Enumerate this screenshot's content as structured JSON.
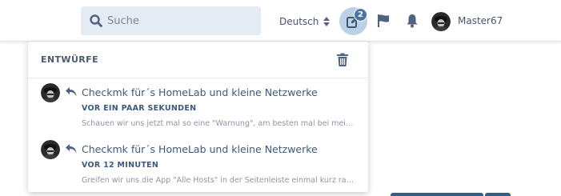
{
  "search": {
    "placeholder": "Suche"
  },
  "header": {
    "language": "Deutsch",
    "drafts_badge": "2",
    "username": "Master67"
  },
  "icons": {
    "search": "search-icon",
    "language_caret": "sort-caret-icon",
    "drafts": "edit-icon",
    "review": "flag-icon",
    "notifications": "bell-icon",
    "delete": "trash-icon",
    "reply": "reply-icon"
  },
  "colors": {
    "accent": "#4b74a8",
    "link": "#3c5a7c",
    "search_bg": "#e4ebf3",
    "active_button_bg": "#bcd0e6"
  },
  "drafts_panel": {
    "title": "ENTWÜRFE",
    "items": [
      {
        "title": "Checkmk für´s HomeLab und kleine Netzwerke",
        "time": "VOR EIN PAAR SEKUNDEN",
        "excerpt": "Schauen wir uns jetzt mal so eine \"Warnung\", am besten mal bei meiner Fritzbox an."
      },
      {
        "title": "Checkmk für´s HomeLab und kleine Netzwerke",
        "time": "VOR 12 MINUTEN",
        "excerpt": "Greifen wir uns die App \"Alle Hosts\" in der Seitenleiste einmal kurz raus und schauen genauer hin."
      }
    ]
  }
}
